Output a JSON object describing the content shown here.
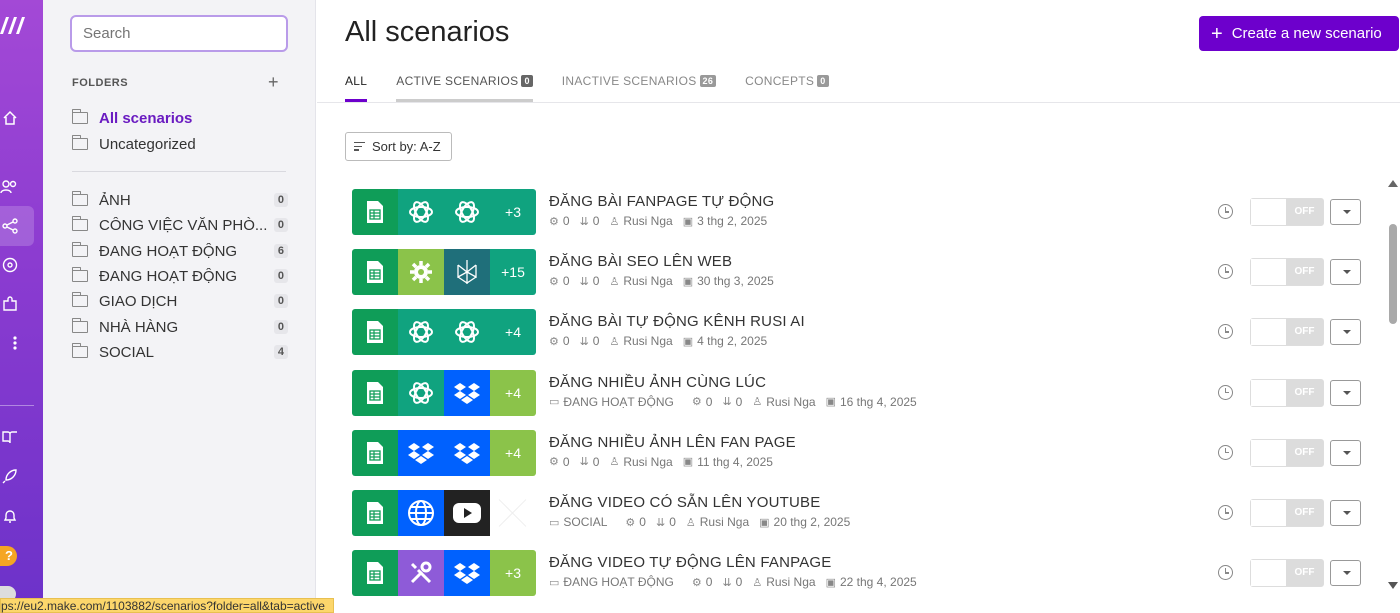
{
  "sidebar": {
    "search_placeholder": "Search",
    "folders_heading": "FOLDERS",
    "add_label": "+",
    "system_folders": [
      {
        "label": "All scenarios"
      },
      {
        "label": "Uncategorized"
      }
    ],
    "folders": [
      {
        "label": "ẢNH",
        "count": "0"
      },
      {
        "label": "CÔNG VIỆC VĂN PHÒ...",
        "count": "0"
      },
      {
        "label": "ĐANG HOẠT ĐỘNG",
        "count": "6"
      },
      {
        "label": "ĐANG HOẠT ĐỘNG",
        "count": "0"
      },
      {
        "label": "GIAO DỊCH",
        "count": "0"
      },
      {
        "label": "NHÀ HÀNG",
        "count": "0"
      },
      {
        "label": "SOCIAL",
        "count": "4"
      }
    ]
  },
  "main": {
    "title": "All scenarios",
    "create_button": "Create a new scenario",
    "tabs": [
      {
        "label": "ALL",
        "count": ""
      },
      {
        "label": "ACTIVE SCENARIOS",
        "count": "0"
      },
      {
        "label": "INACTIVE SCENARIOS",
        "count": "26"
      },
      {
        "label": "CONCEPTS",
        "count": "0"
      }
    ],
    "sort_label": "Sort by: A-Z",
    "toggle_off_label": "OFF"
  },
  "scenarios": [
    {
      "title": "ĐĂNG BÀI FANPAGE TỰ ĐỘNG",
      "folder": "",
      "ops": "0",
      "data": "0",
      "owner": "Rusi Nga",
      "date": "3 thg 2, 2025",
      "more": "+3",
      "apps": [
        "sheets-icon",
        "openai-icon",
        "openai-icon"
      ]
    },
    {
      "title": "ĐĂNG BÀI SEO LÊN WEB",
      "folder": "",
      "ops": "0",
      "data": "0",
      "owner": "Rusi Nga",
      "date": "30 thg 3, 2025",
      "more": "+15",
      "apps": [
        "sheets-icon",
        "gear-icon",
        "perplexity-icon"
      ]
    },
    {
      "title": "ĐĂNG BÀI TỰ ĐỘNG KÊNH RUSI AI",
      "folder": "",
      "ops": "0",
      "data": "0",
      "owner": "Rusi Nga",
      "date": "4 thg 2, 2025",
      "more": "+4",
      "apps": [
        "sheets-icon",
        "openai-icon",
        "openai-icon"
      ]
    },
    {
      "title": "ĐĂNG NHIỀU ẢNH CÙNG LÚC",
      "folder": "ĐANG HOẠT ĐỘNG",
      "ops": "0",
      "data": "0",
      "owner": "Rusi Nga",
      "date": "16 thg 4, 2025",
      "more": "+4",
      "apps": [
        "sheets-icon",
        "openai-icon",
        "dropbox-icon"
      ]
    },
    {
      "title": "ĐĂNG NHIỀU ẢNH LÊN FAN PAGE",
      "folder": "",
      "ops": "0",
      "data": "0",
      "owner": "Rusi Nga",
      "date": "11 thg 4, 2025",
      "more": "+4",
      "apps": [
        "sheets-icon",
        "dropbox-icon",
        "dropbox-icon"
      ]
    },
    {
      "title": "ĐĂNG VIDEO CÓ SẴN LÊN YOUTUBE",
      "folder": "SOCIAL",
      "ops": "0",
      "data": "0",
      "owner": "Rusi Nga",
      "date": "20 thg 2, 2025",
      "more": "",
      "apps": [
        "sheets-icon",
        "globe-icon",
        "youtube-icon"
      ]
    },
    {
      "title": "ĐĂNG VIDEO TỰ ĐỘNG LÊN FANPAGE",
      "folder": "ĐANG HOẠT ĐỘNG",
      "ops": "0",
      "data": "0",
      "owner": "Rusi Nga",
      "date": "22 thg 4, 2025",
      "more": "+3",
      "apps": [
        "sheets-icon",
        "tools-icon",
        "dropbox-icon"
      ]
    }
  ],
  "status_bar_url": "ps://eu2.make.com/1103882/scenarios?folder=all&tab=active",
  "colors": {
    "accent": "#6d00cc",
    "rail_top": "#a349d6",
    "sheets_green": "#0f9d58",
    "openai_teal": "#10a37f",
    "dropbox_blue": "#0061fe",
    "more_green": "#8bc34a"
  }
}
